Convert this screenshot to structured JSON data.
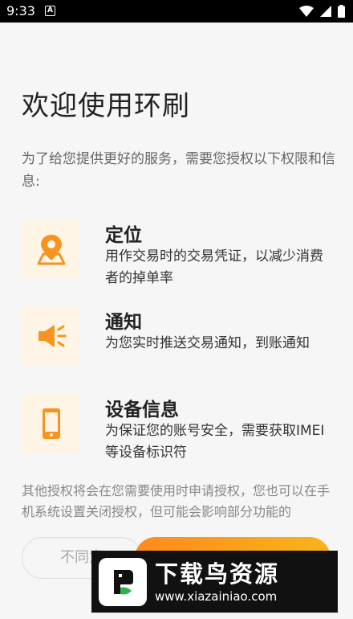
{
  "status_bar": {
    "time": "9:33",
    "app_icon_letter": "A",
    "icons": [
      "wifi-icon",
      "signal-icon",
      "battery-icon"
    ]
  },
  "page": {
    "title": "欢迎使用环刷",
    "intro": "为了给您提供更好的服务，需要您授权以下权限和信息:"
  },
  "permissions": [
    {
      "icon": "location-icon",
      "title": "定位",
      "desc": "用作交易时的交易凭证，以减少消费者的掉单率"
    },
    {
      "icon": "notification-icon",
      "title": "通知",
      "desc": "为您实时推送交易通知，到账通知"
    },
    {
      "icon": "device-icon",
      "title": "设备信息",
      "desc": "为保证您的账号安全，需要获取IMEI等设备标识符"
    }
  ],
  "footer_note": "其他授权将会在您需要使用时申请授权，您也可以在手机系统设置关闭授权，但可能会影响部分功能的",
  "buttons": {
    "disagree": "不同意",
    "agree": ""
  },
  "watermark": {
    "title": "下载鸟资源",
    "url": "www.xiazainiao.com"
  },
  "colors": {
    "accent": "#f7931e",
    "icon_bg": "#fff5e6"
  }
}
